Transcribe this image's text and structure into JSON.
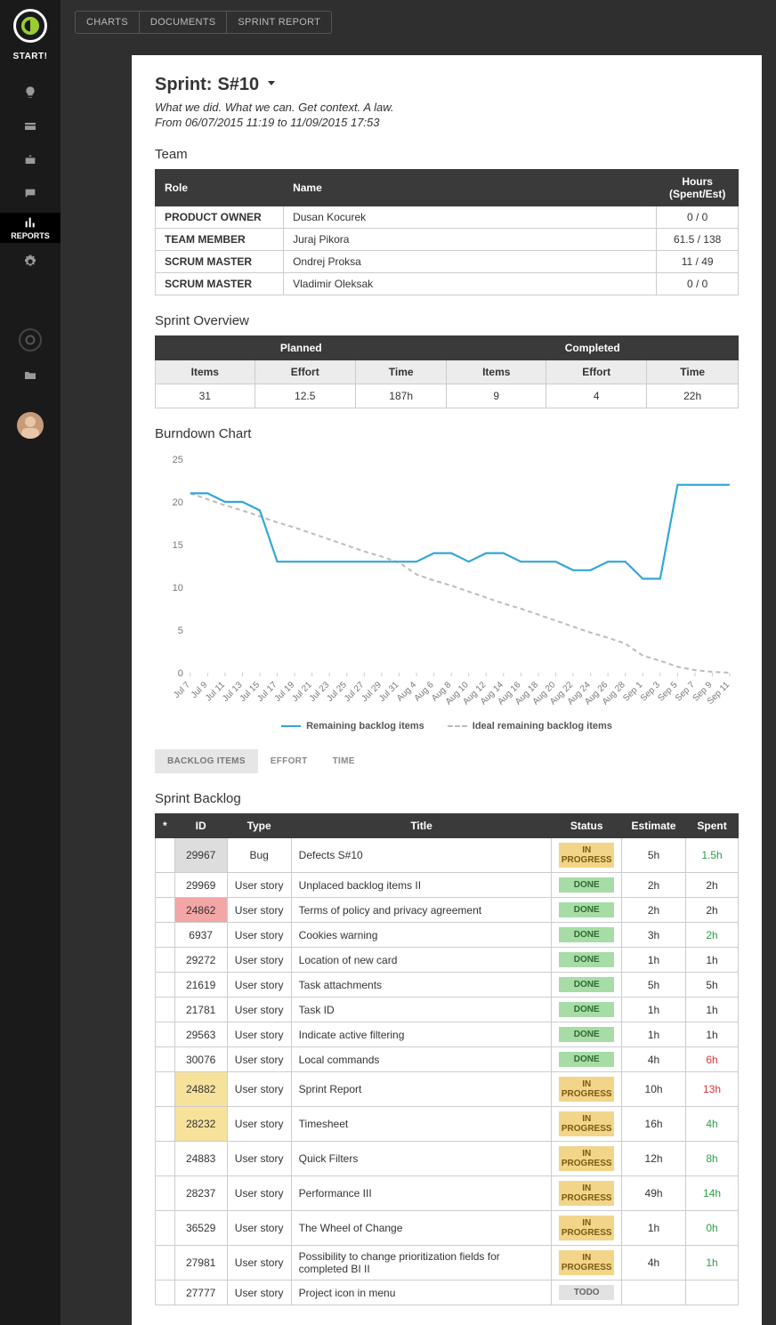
{
  "brand": {
    "start_label": "START!"
  },
  "sidebar": {
    "items": [
      {
        "name": "bulb-icon"
      },
      {
        "name": "card-icon"
      },
      {
        "name": "briefcase-icon"
      },
      {
        "name": "chat-icon"
      },
      {
        "name": "reports-icon",
        "label": "REPORTS",
        "active": true
      },
      {
        "name": "gear-icon"
      }
    ]
  },
  "topbar": {
    "tabs": [
      "CHARTS",
      "DOCUMENTS",
      "SPRINT REPORT"
    ]
  },
  "report": {
    "title_prefix": "Sprint: ",
    "sprint_name": "S#10",
    "subtitle": "What we did. What we can. Get context. A law.",
    "dates": "From 06/07/2015 11:19 to 11/09/2015 17:53"
  },
  "team": {
    "heading": "Team",
    "columns": {
      "role": "Role",
      "name": "Name",
      "hours": "Hours (Spent/Est)"
    },
    "rows": [
      {
        "role": "PRODUCT OWNER",
        "person": "Dusan Kocurek",
        "hours": "0 / 0"
      },
      {
        "role": "TEAM MEMBER",
        "person": "Juraj Pikora",
        "hours": "61.5 / 138"
      },
      {
        "role": "SCRUM MASTER",
        "person": "Ondrej Proksa",
        "hours": "11 / 49"
      },
      {
        "role": "SCRUM MASTER",
        "person": "Vladimir Oleksak",
        "hours": "0 / 0"
      }
    ]
  },
  "overview": {
    "heading": "Sprint Overview",
    "groups": {
      "planned": "Planned",
      "completed": "Completed"
    },
    "sub": {
      "items": "Items",
      "effort": "Effort",
      "time": "Time"
    },
    "planned": {
      "items": "31",
      "effort": "12.5",
      "time": "187h"
    },
    "completed": {
      "items": "9",
      "effort": "4",
      "time": "22h"
    }
  },
  "burndown": {
    "heading": "Burndown Chart",
    "legend": {
      "remaining": "Remaining backlog items",
      "ideal": "Ideal remaining backlog items"
    }
  },
  "chart_data": {
    "type": "line",
    "title": "Burndown Chart",
    "xlabel": "",
    "ylabel": "",
    "ylim": [
      0,
      25
    ],
    "x": [
      "Jul 7",
      "Jul 9",
      "Jul 11",
      "Jul 13",
      "Jul 15",
      "Jul 17",
      "Jul 19",
      "Jul 21",
      "Jul 23",
      "Jul 25",
      "Jul 27",
      "Jul 29",
      "Jul 31",
      "Aug 4",
      "Aug 6",
      "Aug 8",
      "Aug 10",
      "Aug 12",
      "Aug 14",
      "Aug 16",
      "Aug 18",
      "Aug 20",
      "Aug 22",
      "Aug 24",
      "Aug 26",
      "Aug 28",
      "Sep 1",
      "Sep 3",
      "Sep 5",
      "Sep 7",
      "Sep 9",
      "Sep 11"
    ],
    "series": [
      {
        "name": "Remaining backlog items",
        "values": [
          21,
          21,
          20,
          20,
          19,
          13,
          13,
          13,
          13,
          13,
          13,
          13,
          13,
          13,
          14,
          14,
          13,
          14,
          14,
          13,
          13,
          13,
          12,
          12,
          13,
          13,
          11,
          11,
          22,
          22,
          22,
          22
        ]
      },
      {
        "name": "Ideal remaining backlog items",
        "values": [
          21,
          20.3,
          19.6,
          19,
          18.3,
          17.6,
          17,
          16.3,
          15.6,
          14.9,
          14.2,
          13.6,
          12.9,
          11.5,
          10.8,
          10.2,
          9.5,
          8.8,
          8.1,
          7.5,
          6.8,
          6.1,
          5.4,
          4.7,
          4.1,
          3.4,
          2,
          1.4,
          0.7,
          0.3,
          0.1,
          0
        ]
      }
    ]
  },
  "subtabs": {
    "backlog": "BACKLOG ITEMS",
    "effort": "EFFORT",
    "time": "TIME",
    "active": "backlog"
  },
  "backlog": {
    "heading": "Sprint Backlog",
    "columns": {
      "star": "*",
      "id": "ID",
      "type": "Type",
      "title": "Title",
      "status": "Status",
      "estimate": "Estimate",
      "spent": "Spent"
    },
    "rows": [
      {
        "id": "29967",
        "id_style": "grey",
        "type": "Bug",
        "title": "Defects S#10",
        "status": "IN PROGRESS",
        "estimate": "5h",
        "spent": "1.5h",
        "spent_style": "good"
      },
      {
        "id": "29969",
        "id_style": "",
        "type": "User story",
        "title": "Unplaced backlog items II",
        "status": "DONE",
        "estimate": "2h",
        "spent": "2h"
      },
      {
        "id": "24862",
        "id_style": "red",
        "type": "User story",
        "title": "Terms of policy and privacy agreement",
        "status": "DONE",
        "estimate": "2h",
        "spent": "2h"
      },
      {
        "id": "6937",
        "id_style": "",
        "type": "User story",
        "title": "Cookies warning",
        "status": "DONE",
        "estimate": "3h",
        "spent": "2h",
        "spent_style": "good"
      },
      {
        "id": "29272",
        "id_style": "",
        "type": "User story",
        "title": "Location of new card",
        "status": "DONE",
        "estimate": "1h",
        "spent": "1h"
      },
      {
        "id": "21619",
        "id_style": "",
        "type": "User story",
        "title": "Task attachments",
        "status": "DONE",
        "estimate": "5h",
        "spent": "5h"
      },
      {
        "id": "21781",
        "id_style": "",
        "type": "User story",
        "title": "Task ID",
        "status": "DONE",
        "estimate": "1h",
        "spent": "1h"
      },
      {
        "id": "29563",
        "id_style": "",
        "type": "User story",
        "title": "Indicate active filtering",
        "status": "DONE",
        "estimate": "1h",
        "spent": "1h"
      },
      {
        "id": "30076",
        "id_style": "",
        "type": "User story",
        "title": "Local commands",
        "status": "DONE",
        "estimate": "4h",
        "spent": "6h",
        "spent_style": "over"
      },
      {
        "id": "24882",
        "id_style": "yellow",
        "type": "User story",
        "title": "Sprint Report",
        "status": "IN PROGRESS",
        "estimate": "10h",
        "spent": "13h",
        "spent_style": "over"
      },
      {
        "id": "28232",
        "id_style": "yellow",
        "type": "User story",
        "title": "Timesheet",
        "status": "IN PROGRESS",
        "estimate": "16h",
        "spent": "4h",
        "spent_style": "good"
      },
      {
        "id": "24883",
        "id_style": "",
        "type": "User story",
        "title": "Quick Filters",
        "status": "IN PROGRESS",
        "estimate": "12h",
        "spent": "8h",
        "spent_style": "good"
      },
      {
        "id": "28237",
        "id_style": "",
        "type": "User story",
        "title": "Performance III",
        "status": "IN PROGRESS",
        "estimate": "49h",
        "spent": "14h",
        "spent_style": "good"
      },
      {
        "id": "36529",
        "id_style": "",
        "type": "User story",
        "title": "The Wheel of Change",
        "status": "IN PROGRESS",
        "estimate": "1h",
        "spent": "0h",
        "spent_style": "good"
      },
      {
        "id": "27981",
        "id_style": "",
        "type": "User story",
        "title": "Possibility to change prioritization fields for completed BI II",
        "status": "IN PROGRESS",
        "estimate": "4h",
        "spent": "1h",
        "spent_style": "good"
      },
      {
        "id": "27777",
        "id_style": "",
        "type": "User story",
        "title": "Project icon in menu",
        "status": "TODO",
        "estimate": "",
        "spent": ""
      }
    ]
  }
}
